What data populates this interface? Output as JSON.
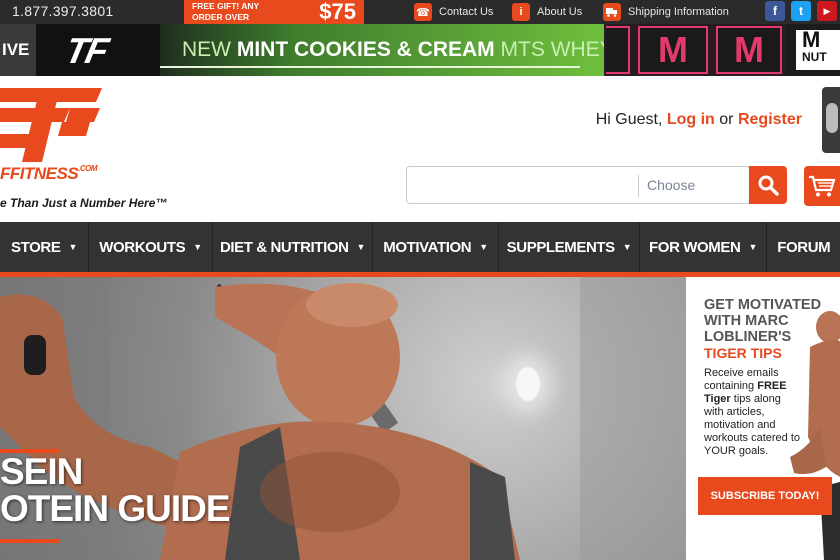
{
  "topbar": {
    "phone": "1.877.397.3801",
    "promo_small": "FREE GIFT! ANY ORDER OVER",
    "promo_amount": "$75",
    "links": [
      {
        "label": "Contact Us",
        "icon": "phone-icon"
      },
      {
        "label": "About Us",
        "icon": "info-icon"
      },
      {
        "label": "Shipping Information",
        "icon": "truck-icon"
      }
    ],
    "social": [
      {
        "name": "facebook-icon",
        "glyph": "f",
        "color": "#3b5998"
      },
      {
        "name": "twitter-icon",
        "glyph": "t",
        "color": "#1da1f2"
      },
      {
        "name": "youtube-icon",
        "glyph": "▶",
        "color": "#cc181e"
      }
    ]
  },
  "banner": {
    "live_label": "IVE",
    "tf_logo": "TF",
    "mint_prefix": "NEW",
    "mint_main": "MINT COOKIES & CREAM",
    "mint_suffix": "MTS WHEY",
    "tub_letter": "M",
    "brand_cut_top": "M",
    "brand_cut_bottom": "NUT"
  },
  "header": {
    "brand_word": "FFITNESS",
    "brand_suffix": ".COM",
    "tagline": "e Than Just a Number Here™",
    "greeting": "Hi Guest,",
    "login": "Log in",
    "or": "or",
    "register": "Register"
  },
  "search": {
    "placeholder": "",
    "category": "Choose"
  },
  "nav": {
    "items": [
      {
        "label": "STORE"
      },
      {
        "label": "WORKOUTS"
      },
      {
        "label": "DIET & NUTRITION"
      },
      {
        "label": "MOTIVATION"
      },
      {
        "label": "SUPPLEMENTS"
      },
      {
        "label": "FOR WOMEN"
      },
      {
        "label": "FORUM"
      }
    ]
  },
  "hero": {
    "line1": "SEIN",
    "line2": "OTEIN GUIDE"
  },
  "side_promo": {
    "headline": "GET MOTIVATED WITH MARC LOBLINER'S",
    "highlight": "TIGER TIPS",
    "body_pre": "Receive emails containing",
    "body_free": "FREE",
    "body_tiger": "Tiger",
    "body_post": "tips along with articles, motivation and workouts catered to YOUR goals.",
    "button": "SUBSCRIBE TODAY!"
  },
  "colors": {
    "accent": "#e8491d",
    "nav_bg": "#333333",
    "top_bg": "#2b2b2b"
  }
}
